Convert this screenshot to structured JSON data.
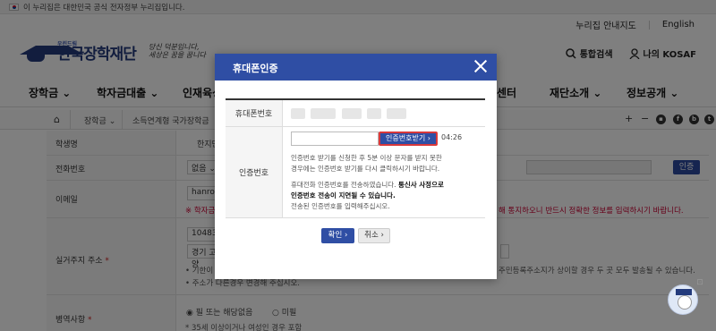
{
  "gov_banner": "이 누리집은 대한민국 공식 전자정부 누리집입니다.",
  "top_links": {
    "sitemap": "누리집 안내지도",
    "english": "English"
  },
  "logo": {
    "small": "우린드림",
    "main": "한국장학재단",
    "slogan_1": "당신 덕분입니다,",
    "slogan_2": "세상은 꿈을 꿉니다"
  },
  "header_right": {
    "search": "통합검색",
    "my": "나의 KOSAF"
  },
  "nav": [
    "장학금",
    "학자금대출",
    "인재육성",
    "센터",
    "재단소개",
    "정보공개"
  ],
  "breadcrumb": [
    "장학금",
    "소득연계형 국가장학금"
  ],
  "form": {
    "student_label": "학생명",
    "student_value": "한지민",
    "phone_label": "전화번호",
    "phone_select": "없음",
    "email_label": "이메일",
    "email_value": "hanrosa",
    "email_warn_left": "※ 학자금",
    "email_warn_right": "해 통지하오니 반드시 정확한 정보를 입력하시기 바랍니다.",
    "address_label": "실거주지 주소",
    "zip": "10483",
    "addr_prefix": "경기 고양",
    "addr_note_1_left": "• 기한이",
    "addr_note_1_right": "주민등록주소지가 상이할 경우 두 곳 모두 발송될 수 있습니다.",
    "addr_note_2": "• 주소가 다른경우 변경해 주십시오.",
    "military_label": "병역사항",
    "military_opt1": "필 또는 해당없음",
    "military_opt2": "미필",
    "military_note": "* 35세 이상이거나 여성인 경우 포함",
    "required_mark": "*",
    "cert_button": "인증"
  },
  "modal": {
    "title": "휴대폰인증",
    "phone_label": "휴대폰번호",
    "cert_label": "인증번호",
    "request_button": "인증번호받기",
    "timer": "04:26",
    "desc_1": "인증번호 받기를 신청한 후 5분 이상 문자를 받지 못한",
    "desc_2": "경우에는 인증번호 받기를 다시 클릭하시기 바랍니다.",
    "desc_3_prefix": "휴대전화 인증번호를 전송하였습니다.",
    "desc_3_bold": "통신사 사정으로",
    "desc_4_bold": "인증번호 전송이 지연될 수 있습니다.",
    "desc_5": "전송된 인증번호를 입력해주십시오.",
    "confirm_button": "확인",
    "cancel_button": "취소"
  },
  "icons": {
    "search": "search-icon",
    "user": "user-icon",
    "home": "home-icon",
    "close": "close-icon",
    "chatbot": "chatbot-icon"
  },
  "colors": {
    "brand": "#2f4ea4",
    "header": "#2f4ea4",
    "warn": "#c03",
    "highlight": "#d9383a"
  }
}
